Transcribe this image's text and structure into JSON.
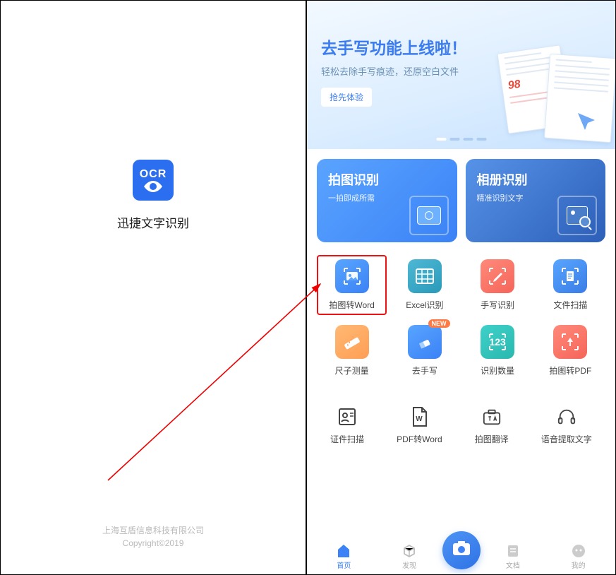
{
  "left": {
    "ocr_label": "OCR",
    "app_name": "迅捷文字识别",
    "company": "上海互盾信息科技有限公司",
    "copyright": "Copyright©2019"
  },
  "banner": {
    "title": "去手写功能上线啦！",
    "subtitle": "轻松去除手写痕迹，还原空白文件",
    "button": "抢先体验",
    "doc_mark": "98"
  },
  "primary": [
    {
      "title": "拍图识别",
      "sub": "一拍即成所需"
    },
    {
      "title": "相册识别",
      "sub": "精准识别文字"
    }
  ],
  "grid_row1": [
    {
      "label": "拍图转Word",
      "name": "photo-to-word"
    },
    {
      "label": "Excel识别",
      "name": "excel-ocr"
    },
    {
      "label": "手写识别",
      "name": "handwriting-ocr"
    },
    {
      "label": "文件扫描",
      "name": "file-scan"
    }
  ],
  "grid_row2": [
    {
      "label": "尺子测量",
      "name": "ruler-measure"
    },
    {
      "label": "去手写",
      "name": "remove-handwriting",
      "badge": "NEW"
    },
    {
      "label": "识别数量",
      "name": "count-ocr",
      "text": "123"
    },
    {
      "label": "拍图转PDF",
      "name": "photo-to-pdf"
    }
  ],
  "secondary": [
    {
      "label": "证件扫描",
      "name": "id-scan"
    },
    {
      "label": "PDF转Word",
      "name": "pdf-to-word",
      "tag": "W"
    },
    {
      "label": "拍图翻译",
      "name": "photo-translate"
    },
    {
      "label": "语音提取文字",
      "name": "voice-to-text"
    }
  ],
  "tabs": [
    {
      "label": "首页",
      "name": "tab-home"
    },
    {
      "label": "发现",
      "name": "tab-discover"
    },
    {
      "label": "文档",
      "name": "tab-docs"
    },
    {
      "label": "我的",
      "name": "tab-me"
    }
  ]
}
